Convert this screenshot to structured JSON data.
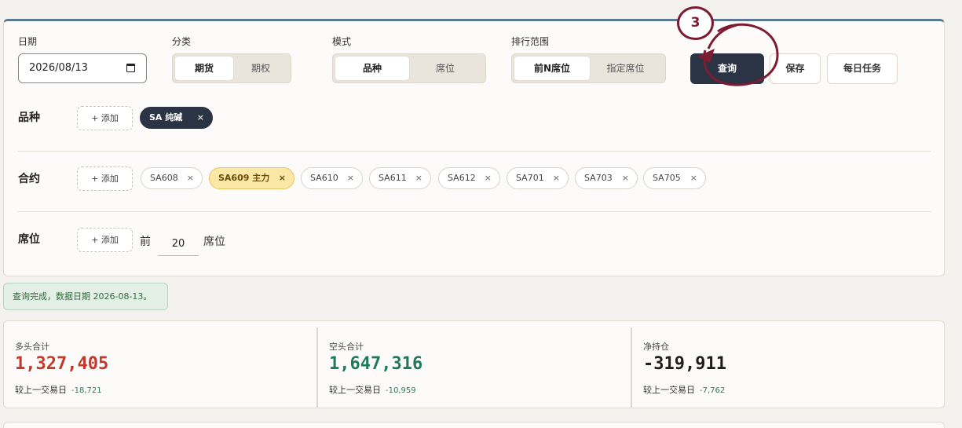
{
  "filters": {
    "date_label": "日期",
    "date_value": "2026/08/13",
    "category_label": "分类",
    "category_options": [
      "期货",
      "期权"
    ],
    "mode_label": "模式",
    "mode_options": [
      "品种",
      "席位"
    ],
    "rank_label": "排行范围",
    "rank_options": [
      "前N席位",
      "指定席位"
    ],
    "query_label": "查询",
    "save_label": "保存",
    "daily_label": "每日任务"
  },
  "variety": {
    "label": "品种",
    "add_label": "+ 添加",
    "chip": "SA 纯碱"
  },
  "contract": {
    "label": "合约",
    "add_label": "+ 添加",
    "chips": [
      "SA608",
      "SA609 主力",
      "SA610",
      "SA611",
      "SA612",
      "SA701",
      "SA703",
      "SA705"
    ],
    "main_chip_color": "#fbe7a8"
  },
  "seat": {
    "label": "席位",
    "add_label": "+ 添加",
    "prefix": "前",
    "count": "20",
    "suffix": "席位"
  },
  "status": "查询完成，数据日期 2026-08-13。",
  "stats": [
    {
      "label": "多头合计",
      "value": "1,327,405",
      "compare_label": "较上一交易日",
      "change": "-18,721",
      "color": "#c0392b"
    },
    {
      "label": "空头合计",
      "value": "1,647,316",
      "compare_label": "较上一交易日",
      "change": "-10,959",
      "color": "#1f7a5a"
    },
    {
      "label": "净持仓",
      "value": "-319,911",
      "compare_label": "较上一交易日",
      "change": "-7,762",
      "color": "#1e1e1e"
    }
  ],
  "annotation": {
    "step": "3",
    "color": "#7d1b33"
  },
  "icons": {
    "calendar": "calendar-icon",
    "close": "close-icon"
  }
}
